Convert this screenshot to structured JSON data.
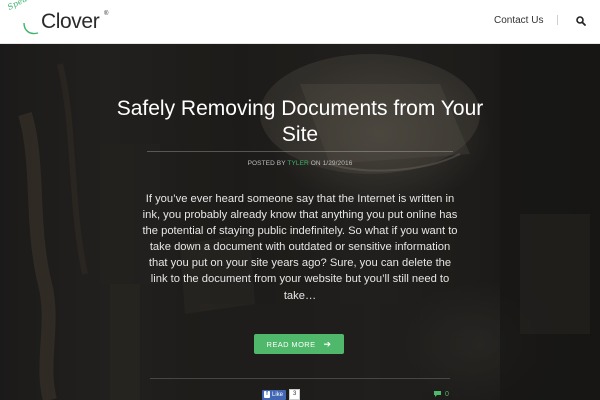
{
  "header": {
    "logo": {
      "script_text": "Speaking of",
      "word": "Clover",
      "reg": "®"
    },
    "nav": {
      "contact_label": "Contact Us"
    },
    "icons": {
      "search": "search-icon"
    }
  },
  "post": {
    "title": "Safely Removing Documents from Your Site",
    "byline_prefix": "POSTED BY",
    "author": "TYLER",
    "byline_on": "ON",
    "date": "1/29/2016",
    "excerpt": "If you’ve ever heard someone say that the Internet is written in ink, you probably already know that anything you put online has the potential of staying public indefinitely. So what if you want to take down a document with outdated or sensitive information that you put on your site years ago? Sure, you can delete the link to the document from your website but you’ll still need to take…",
    "read_more_label": "READ MORE",
    "read_more_icon": "arrow-right-icon"
  },
  "social": {
    "fb_label": "Like",
    "fb_count": "3",
    "comment_count": "0",
    "comment_icon": "comment-icon"
  },
  "colors": {
    "accent": "#4fb86a",
    "brand_green": "#3db36b",
    "facebook": "#4267b2"
  }
}
